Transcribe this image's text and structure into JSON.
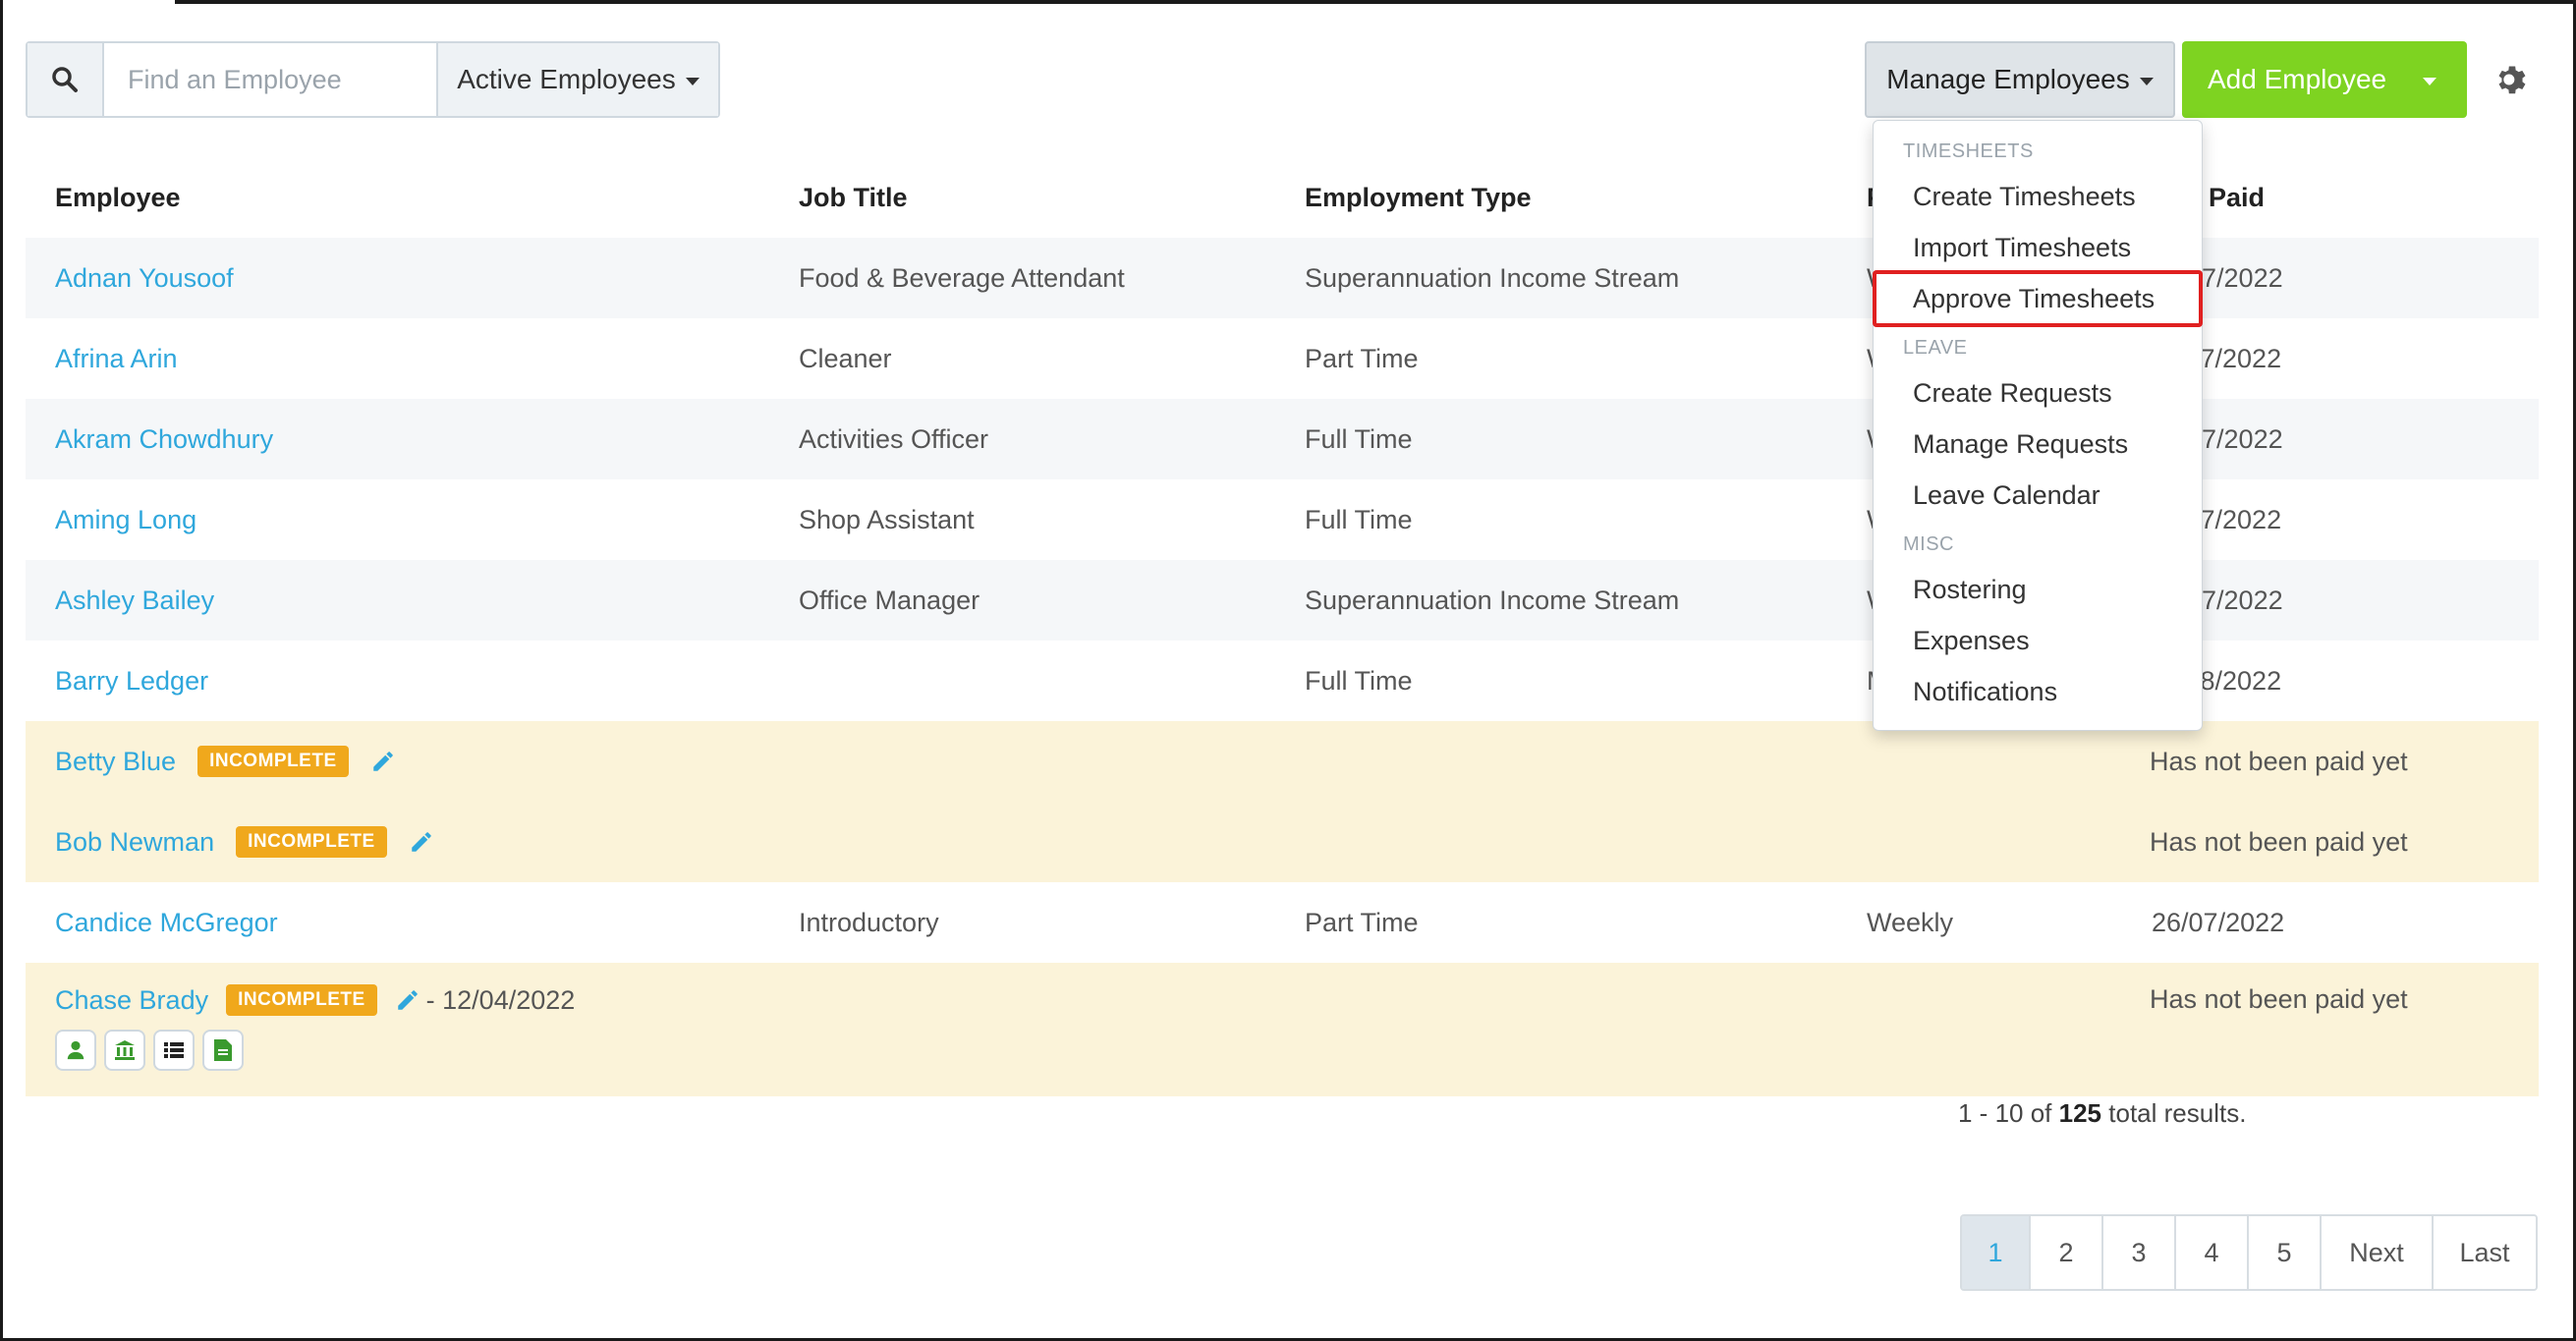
{
  "search": {
    "placeholder": "Find an Employee",
    "filter_label": "Active Employees"
  },
  "header": {
    "manage_label": "Manage Employees",
    "add_label": "Add Employee"
  },
  "table": {
    "headers": [
      "Employee",
      "Job Title",
      "Employment Type",
      "P",
      "Paid"
    ],
    "rows": [
      {
        "name": "Adnan Yousoof",
        "job": "Food & Beverage Attendant",
        "type": "Superannuation Income Stream",
        "period": "W",
        "paid": "07/2022"
      },
      {
        "name": "Afrina Arin",
        "job": "Cleaner",
        "type": "Part Time",
        "period": "W",
        "paid": "/7/2022"
      },
      {
        "name": "Akram Chowdhury",
        "job": "Activities Officer",
        "type": "Full Time",
        "period": "W",
        "paid": "07/2022"
      },
      {
        "name": "Aming Long",
        "job": "Shop Assistant",
        "type": "Full Time",
        "period": "W",
        "paid": "/7/2022"
      },
      {
        "name": "Ashley Bailey",
        "job": "Office Manager",
        "type": "Superannuation Income Stream",
        "period": "W",
        "paid": "07/2022"
      },
      {
        "name": "Barry Ledger",
        "job": "",
        "type": "Full Time",
        "period": "M",
        "paid": "/8/2022"
      },
      {
        "name": "Betty Blue",
        "badge": "INCOMPLETE",
        "paid": "Has not been paid yet"
      },
      {
        "name": "Bob Newman",
        "badge": "INCOMPLETE",
        "paid": "Has not been paid yet"
      },
      {
        "name": "Candice McGregor",
        "job": "Introductory",
        "type": "Part Time",
        "period": "Weekly",
        "paid": "26/07/2022"
      },
      {
        "name": "Chase Brady",
        "badge": "INCOMPLETE",
        "date": "- 12/04/2022",
        "paid": "Has not been paid yet"
      }
    ]
  },
  "results": {
    "prefix": "1 - 10 of",
    "total": "125",
    "suffix": "total results."
  },
  "pagination": [
    "1",
    "2",
    "3",
    "4",
    "5",
    "Next",
    "Last"
  ],
  "dropdown": {
    "timesheets_head": "TIMESHEETS",
    "create_timesheets": "Create Timesheets",
    "import_timesheets": "Import Timesheets",
    "approve_timesheets": "Approve Timesheets",
    "leave_head": "LEAVE",
    "create_requests": "Create Requests",
    "manage_requests": "Manage Requests",
    "leave_calendar": "Leave Calendar",
    "misc_head": "MISC",
    "rostering": "Rostering",
    "expenses": "Expenses",
    "notifications": "Notifications"
  },
  "colors": {
    "link": "#2fa7dc",
    "add_button": "#7ed321",
    "badge": "#f0a81c",
    "warn_row": "#fbf3d9",
    "highlight": "#e02020"
  }
}
